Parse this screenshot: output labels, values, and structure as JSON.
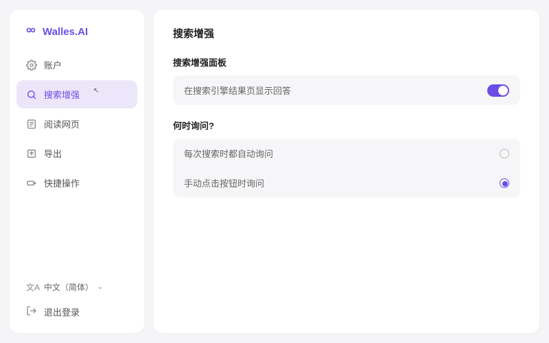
{
  "brand": {
    "name": "Walles.AI"
  },
  "sidebar": {
    "items": [
      {
        "label": "账户"
      },
      {
        "label": "搜索增强"
      },
      {
        "label": "阅读网页"
      },
      {
        "label": "导出"
      },
      {
        "label": "快捷操作"
      }
    ],
    "language": {
      "label": "中文（简体）"
    },
    "logout": {
      "label": "退出登录"
    }
  },
  "main": {
    "title": "搜索增强",
    "panel_label": "搜索增强面板",
    "toggle_row": {
      "label": "在搜索引擎结果页显示回答",
      "on": true
    },
    "when_label": "何时询问?",
    "options": [
      {
        "label": "每次搜索时都自动询问",
        "selected": false
      },
      {
        "label": "手动点击按钮时询问",
        "selected": true
      }
    ]
  }
}
